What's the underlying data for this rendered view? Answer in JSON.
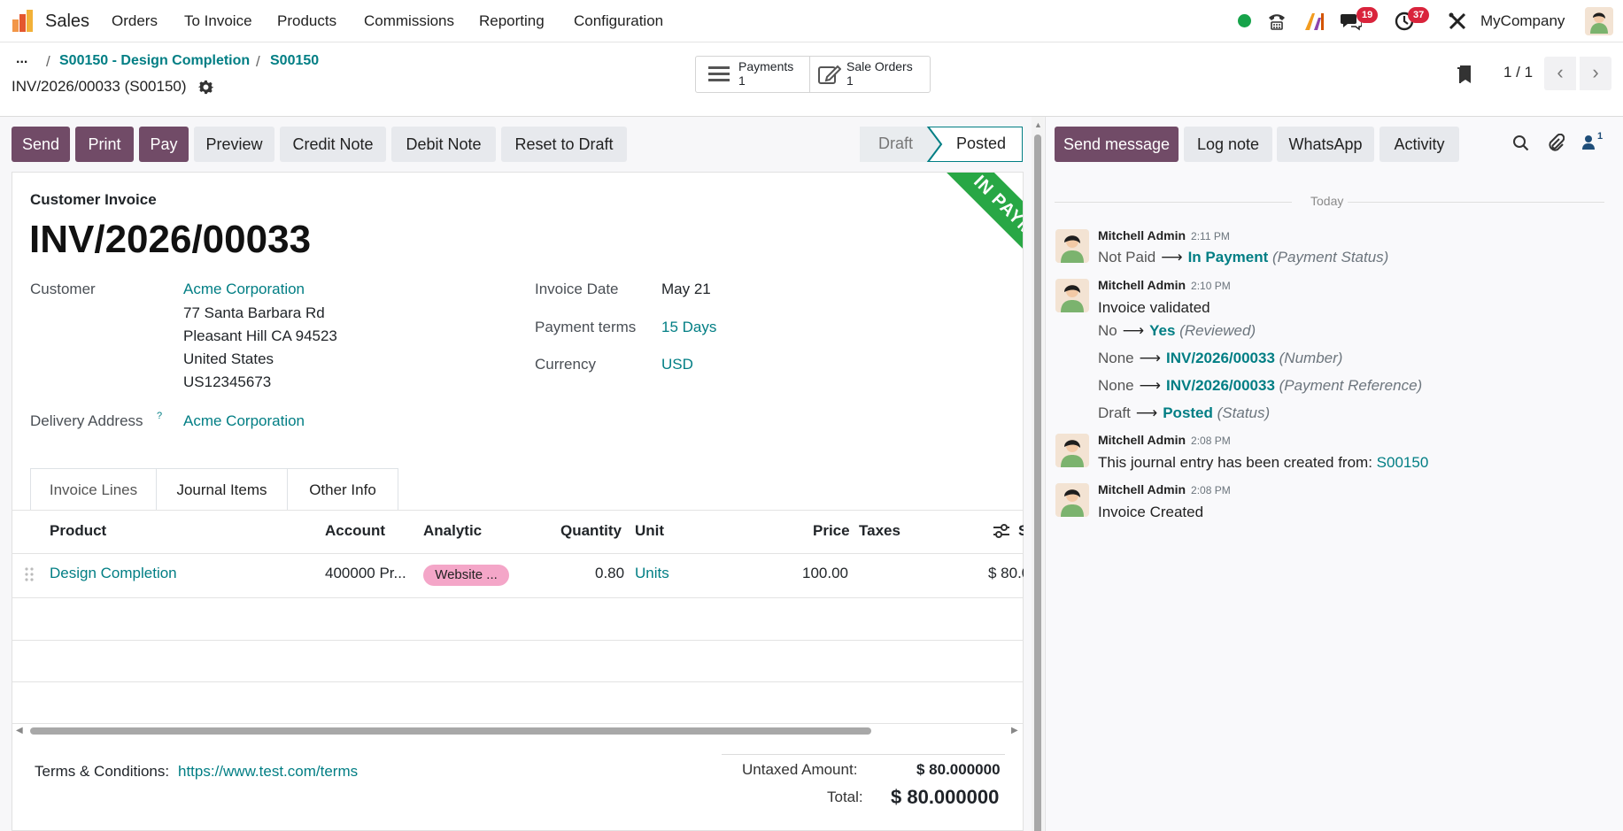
{
  "navbar": {
    "app_name": "Sales",
    "menus": [
      "Orders",
      "To Invoice",
      "Products",
      "Commissions",
      "Reporting",
      "Configuration"
    ],
    "messages_count": "19",
    "activities_count": "37",
    "company": "MyCompany"
  },
  "breadcrumb": {
    "ellipsis": "...",
    "items": [
      "S00150 - Design Completion",
      "S00150"
    ],
    "current": "INV/2026/00033 (S00150)"
  },
  "smart_buttons": [
    {
      "label": "Payments",
      "count": "1"
    },
    {
      "label": "Sale Orders",
      "count": "1"
    }
  ],
  "pager": {
    "value": "1 / 1"
  },
  "actions": [
    "Send",
    "Print",
    "Pay",
    "Preview",
    "Credit Note",
    "Debit Note",
    "Reset to Draft"
  ],
  "statusbar": {
    "draft": "Draft",
    "posted": "Posted"
  },
  "ribbon": "IN PAYMENT",
  "invoice": {
    "type": "Customer Invoice",
    "number": "INV/2026/00033",
    "customer_label": "Customer",
    "customer_name": "Acme Corporation",
    "address": [
      "77 Santa Barbara Rd",
      "Pleasant Hill CA 94523",
      "United States",
      "US12345673"
    ],
    "delivery_label": "Delivery Address",
    "delivery_help": "?",
    "delivery_value": "Acme Corporation",
    "invoice_date_label": "Invoice Date",
    "invoice_date": "May 21",
    "payment_terms_label": "Payment terms",
    "payment_terms": "15 Days",
    "currency_label": "Currency",
    "currency": "USD"
  },
  "tabs": [
    "Invoice Lines",
    "Journal Items",
    "Other Info"
  ],
  "lines": {
    "headers": {
      "product": "Product",
      "account": "Account",
      "analytic": "Analytic",
      "quantity": "Quantity",
      "unit": "Unit",
      "price": "Price",
      "taxes": "Taxes",
      "subtotal_cut": "S"
    },
    "rows": [
      {
        "product": "Design Completion",
        "account": "400000 Pr...",
        "analytic": "Website ...",
        "quantity": "0.80",
        "unit": "Units",
        "price": "100.00",
        "subtotal": "$ 80.0"
      }
    ]
  },
  "footer": {
    "terms_label": "Terms & Conditions:",
    "terms_link": "https://www.test.com/terms",
    "untaxed_label": "Untaxed Amount:",
    "untaxed_value": "$ 80.000000",
    "total_label": "Total:",
    "total_value": "$ 80.000000"
  },
  "chatter": {
    "buttons": [
      "Send message",
      "Log note",
      "WhatsApp",
      "Activity"
    ],
    "followers_count": "1",
    "date_separator": "Today",
    "messages": [
      {
        "author": "Mitchell Admin",
        "time": "2:11 PM"
      },
      {
        "author": "Mitchell Admin",
        "time": "2:10 PM"
      },
      {
        "author": "Mitchell Admin",
        "time": "2:08 PM"
      },
      {
        "author": "Mitchell Admin",
        "time": "2:08 PM"
      }
    ],
    "m1": {
      "old": "Not Paid",
      "new": "In Payment",
      "field": "(Payment Status)"
    },
    "m2": {
      "body": "Invoice validated",
      "changes": [
        {
          "old": "No",
          "new": "Yes",
          "field": "(Reviewed)"
        },
        {
          "old": "None",
          "new": "INV/2026/00033",
          "field": "(Number)"
        },
        {
          "old": "None",
          "new": "INV/2026/00033",
          "field": "(Payment Reference)"
        },
        {
          "old": "Draft",
          "new": "Posted",
          "field": "(Status)"
        }
      ]
    },
    "m3": {
      "body": "This journal entry has been created from:",
      "link": "S00150"
    },
    "m4": {
      "body": "Invoice Created"
    }
  },
  "colors": {
    "primary": "#714b67",
    "link": "#017e84",
    "ribbon": "#28a745",
    "badge": "#d9243c"
  }
}
